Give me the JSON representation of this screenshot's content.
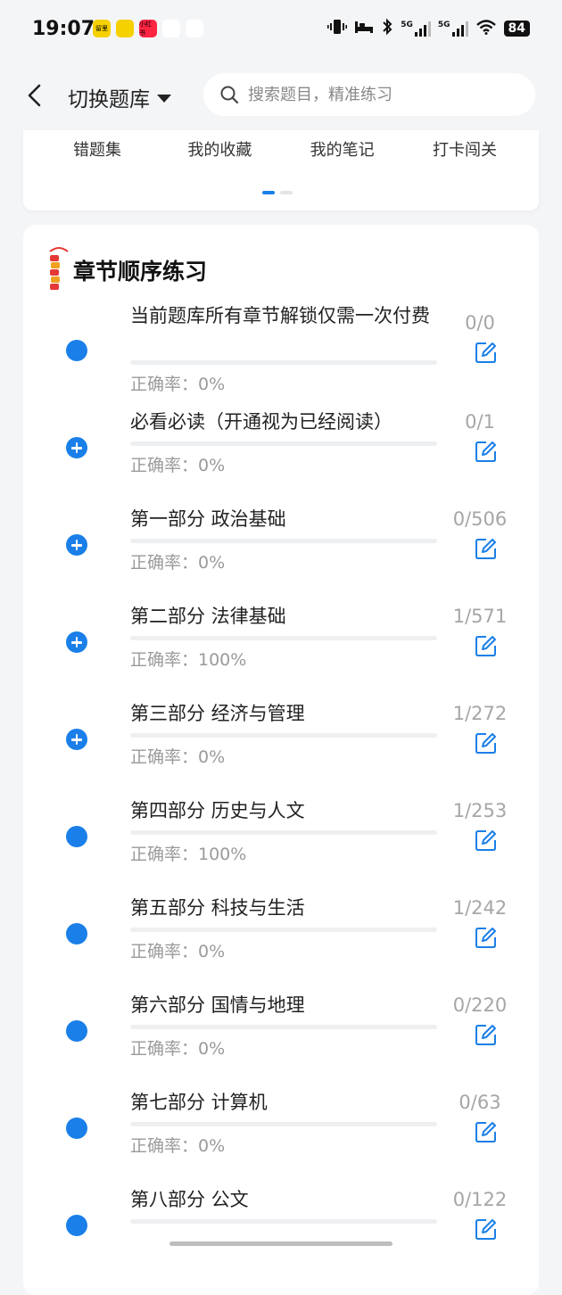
{
  "status_bar": {
    "time": "19:07",
    "app_icons": [
      {
        "name": "app-icon-1",
        "label": "留里",
        "color": "#f6d100"
      },
      {
        "name": "app-icon-2",
        "label": "",
        "color": "#f6d100"
      },
      {
        "name": "app-icon-3",
        "label": "小红书",
        "color": "#ff2442"
      },
      {
        "name": "app-icon-4",
        "label": "",
        "color": "#ffffff"
      },
      {
        "name": "app-icon-5",
        "label": "",
        "color": "#ffffff"
      }
    ],
    "network_1": "5G",
    "network_2": "5G",
    "battery": "84"
  },
  "nav": {
    "title": "切换题库",
    "search_placeholder": "搜索题目，精准练习"
  },
  "shortcuts": [
    "错题集",
    "我的收藏",
    "我的笔记",
    "打卡闯关"
  ],
  "chapter_section": {
    "title": "章节顺序练习",
    "accent_color": "#1a7fe8",
    "chapters": [
      {
        "title": "当前题库所有章节解锁仅需一次付费",
        "count": "0/0",
        "accuracy": "正确率：0%",
        "expandable": false,
        "progress": 0
      },
      {
        "title": "必看必读（开通视为已经阅读）",
        "count": "0/1",
        "accuracy": "正确率：0%",
        "expandable": true,
        "progress": 0
      },
      {
        "title": "第一部分 政治基础",
        "count": "0/506",
        "accuracy": "正确率：0%",
        "expandable": true,
        "progress": 0
      },
      {
        "title": "第二部分 法律基础",
        "count": "1/571",
        "accuracy": "正确率：100%",
        "expandable": true,
        "progress": 0
      },
      {
        "title": "第三部分 经济与管理",
        "count": "1/272",
        "accuracy": "正确率：0%",
        "expandable": true,
        "progress": 0
      },
      {
        "title": "第四部分 历史与人文",
        "count": "1/253",
        "accuracy": "正确率：100%",
        "expandable": false,
        "progress": 0
      },
      {
        "title": "第五部分 科技与生活",
        "count": "1/242",
        "accuracy": "正确率：0%",
        "expandable": false,
        "progress": 0
      },
      {
        "title": "第六部分 国情与地理",
        "count": "0/220",
        "accuracy": "正确率：0%",
        "expandable": false,
        "progress": 0
      },
      {
        "title": "第七部分 计算机",
        "count": "0/63",
        "accuracy": "正确率：0%",
        "expandable": false,
        "progress": 0
      },
      {
        "title": "第八部分 公文",
        "count": "0/122",
        "accuracy": "",
        "expandable": false,
        "progress": 0
      }
    ]
  }
}
